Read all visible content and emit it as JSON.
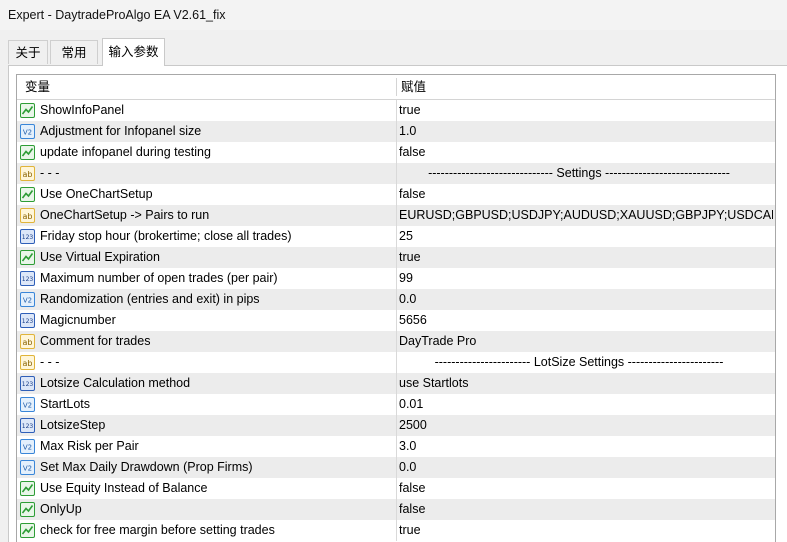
{
  "window": {
    "title": "Expert - DaytradeProAlgo EA V2.61_fix"
  },
  "tabs": [
    {
      "label": "关于"
    },
    {
      "label": "常用"
    },
    {
      "label": "输入参数"
    }
  ],
  "table": {
    "headers": {
      "variable": "变量",
      "value": "赋值"
    },
    "rows": [
      {
        "icon": "bool-icon",
        "name": "ShowInfoPanel",
        "value": "true"
      },
      {
        "icon": "double-icon",
        "name": "Adjustment for Infopanel size",
        "value": "1.0"
      },
      {
        "icon": "bool-icon",
        "name": "update infopanel during testing",
        "value": "false"
      },
      {
        "icon": "string-icon",
        "name": "- - -",
        "value": "------------------------------ Settings ------------------------------"
      },
      {
        "icon": "bool-icon",
        "name": "Use OneChartSetup",
        "value": "false"
      },
      {
        "icon": "string-icon",
        "name": "OneChartSetup -> Pairs to run",
        "value": "EURUSD;GBPUSD;USDJPY;AUDUSD;XAUUSD;GBPJPY;USDCAD;..."
      },
      {
        "icon": "int-icon",
        "name": "Friday stop hour (brokertime; close all trades)",
        "value": "25"
      },
      {
        "icon": "bool-icon",
        "name": "Use Virtual Expiration",
        "value": "true"
      },
      {
        "icon": "int-icon",
        "name": "Maximum number of open trades (per pair)",
        "value": "99"
      },
      {
        "icon": "double-icon",
        "name": "Randomization (entries and exit) in pips",
        "value": "0.0"
      },
      {
        "icon": "int-icon",
        "name": "Magicnumber",
        "value": "5656"
      },
      {
        "icon": "string-icon",
        "name": "Comment for trades",
        "value": "DayTrade Pro"
      },
      {
        "icon": "string-icon",
        "name": "- - -",
        "value": "----------------------- LotSize Settings -----------------------"
      },
      {
        "icon": "int-icon",
        "name": "Lotsize Calculation method",
        "value": "use Startlots"
      },
      {
        "icon": "double-icon",
        "name": "StartLots",
        "value": "0.01"
      },
      {
        "icon": "int-icon",
        "name": "LotsizeStep",
        "value": "2500"
      },
      {
        "icon": "double-icon",
        "name": "Max Risk per Pair",
        "value": "3.0"
      },
      {
        "icon": "double-icon",
        "name": "Set Max Daily Drawdown (Prop Firms)",
        "value": "0.0"
      },
      {
        "icon": "bool-icon",
        "name": "Use Equity Instead of Balance",
        "value": "false"
      },
      {
        "icon": "bool-icon",
        "name": "OnlyUp",
        "value": "false"
      },
      {
        "icon": "bool-icon",
        "name": "check for free margin before setting trades",
        "value": "true"
      }
    ]
  },
  "colors": {
    "row_alt": "#ececec",
    "bool_icon_green": "#2e9d36",
    "string_icon_yellow": "#e0b43a",
    "double_icon_blue": "#3a86d8",
    "int_icon_blue": "#2f5fb8"
  }
}
